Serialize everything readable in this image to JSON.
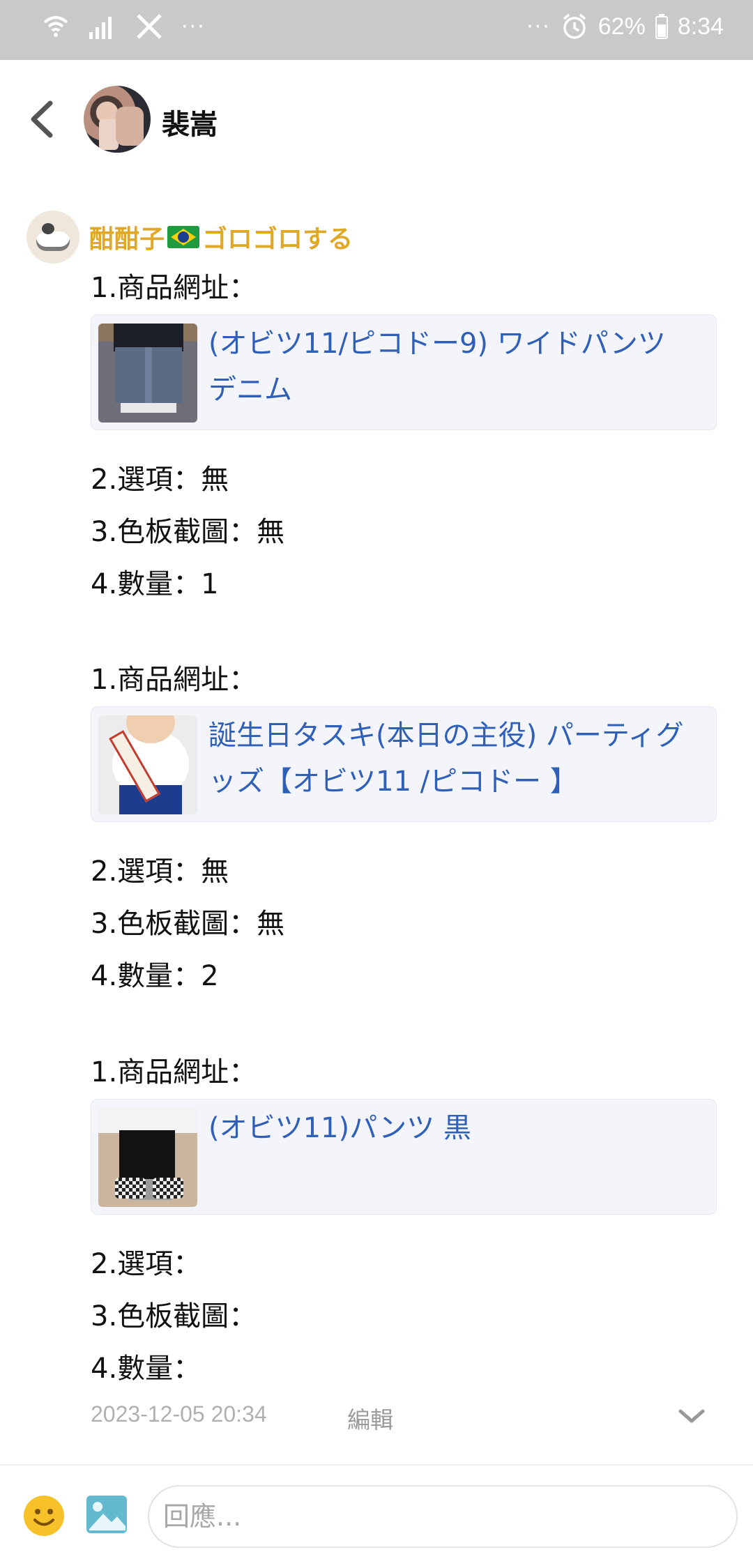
{
  "status_bar": {
    "left_dots": "···",
    "right_dots": "···",
    "battery": "62%",
    "time": "8:34",
    "icons": [
      "wifi-icon",
      "signal-icon",
      "x-logo-icon",
      "alarm-icon",
      "battery-icon"
    ]
  },
  "header": {
    "title": "裴嵩",
    "icons": [
      "back-arrow-icon"
    ]
  },
  "message": {
    "author_name_part1": "酣酣子",
    "author_name_part2": "ゴロゴロする",
    "flag": "brazil-flag-icon",
    "author_color": "#e0a827",
    "items": [
      {
        "url_label": "1.商品網址：",
        "link_title": "(オビツ11/ピコドー9) ワイドパンツ デニム",
        "option": "2.選項：無",
        "color_shot": "3.色板截圖：無",
        "quantity": "4.數量：1"
      },
      {
        "url_label": "1.商品網址：",
        "link_title": "誕生日タスキ(本日の主役) パーティグッズ【オビツ11 /ピコドー 】",
        "option": "2.選項：無",
        "color_shot": "3.色板截圖：無",
        "quantity": "4.數量：2"
      },
      {
        "url_label": "1.商品網址：",
        "link_title": "(オビツ11)パンツ 黒",
        "option": "2.選項：",
        "color_shot": "3.色板截圖：",
        "quantity": "4.數量："
      }
    ],
    "timestamp": "2023-12-05 20:34",
    "edit_label": "編輯",
    "link_color": "#2f5fb6"
  },
  "reply_bar": {
    "placeholder": "回應...",
    "value": "",
    "icons": [
      "emoji-icon",
      "image-icon"
    ]
  }
}
